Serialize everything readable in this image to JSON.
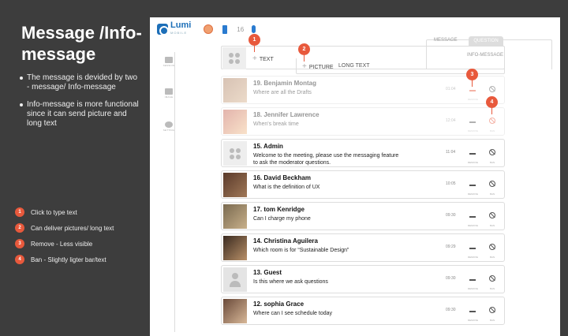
{
  "slide": {
    "title": "Message /Info-message",
    "bullets": [
      "The message is devided by two - message/ Info-message",
      "Info-message is more functional since it can send picture and long text"
    ],
    "legend": [
      {
        "num": "1",
        "text": "Click to type text"
      },
      {
        "num": "2",
        "text": "Can deliver pictures/ long text"
      },
      {
        "num": "3",
        "text": "Remove - Less visible"
      },
      {
        "num": "4",
        "text": "Ban - Slightly ligter bar/text"
      }
    ],
    "accent": "#e8593c"
  },
  "app": {
    "logo": "Lumi",
    "logo_sub": "MOBILE",
    "count": "16",
    "sidebar": [
      "SESSION",
      "IMAGE",
      "SETTING"
    ]
  },
  "composer": {
    "tabs": [
      "MESSAGE",
      "QUESTION",
      "INFO-MESSAGE"
    ],
    "add_text": "TEXT",
    "add_picture": "PICTURE",
    "long_text": "LONG TEXT"
  },
  "messages": [
    {
      "name": "19. Benjamin Montag",
      "text": "Where are all the Drafts",
      "time": "01:04",
      "dim": true
    },
    {
      "name": "18. Jennifer Lawrence",
      "text": "When's break time",
      "time": "12:04",
      "dim": true
    },
    {
      "name": "15. Admin",
      "text": "Welcome to the meeting, please use the messaging feature to ask the moderator questions.",
      "time": "11:04"
    },
    {
      "name": "16. David Beckham",
      "text": "What is the definition of UX",
      "time": "10:05"
    },
    {
      "name": "17. tom Kenridge",
      "text": "Can I charge my phone",
      "time": "09:30"
    },
    {
      "name": "14. Christina Aguilera",
      "text": "Which room is for “Sustainable Design”",
      "time": "09:29"
    },
    {
      "name": "13. Guest",
      "text": "Is this where we ask questions",
      "time": "09:30"
    },
    {
      "name": "12. sophia Grace",
      "text": "Where can I see schedule today",
      "time": "09:30"
    }
  ],
  "row_actions": {
    "remove": "REMOVE",
    "ban": "BAN"
  },
  "markers": [
    "1",
    "2",
    "3",
    "4"
  ]
}
